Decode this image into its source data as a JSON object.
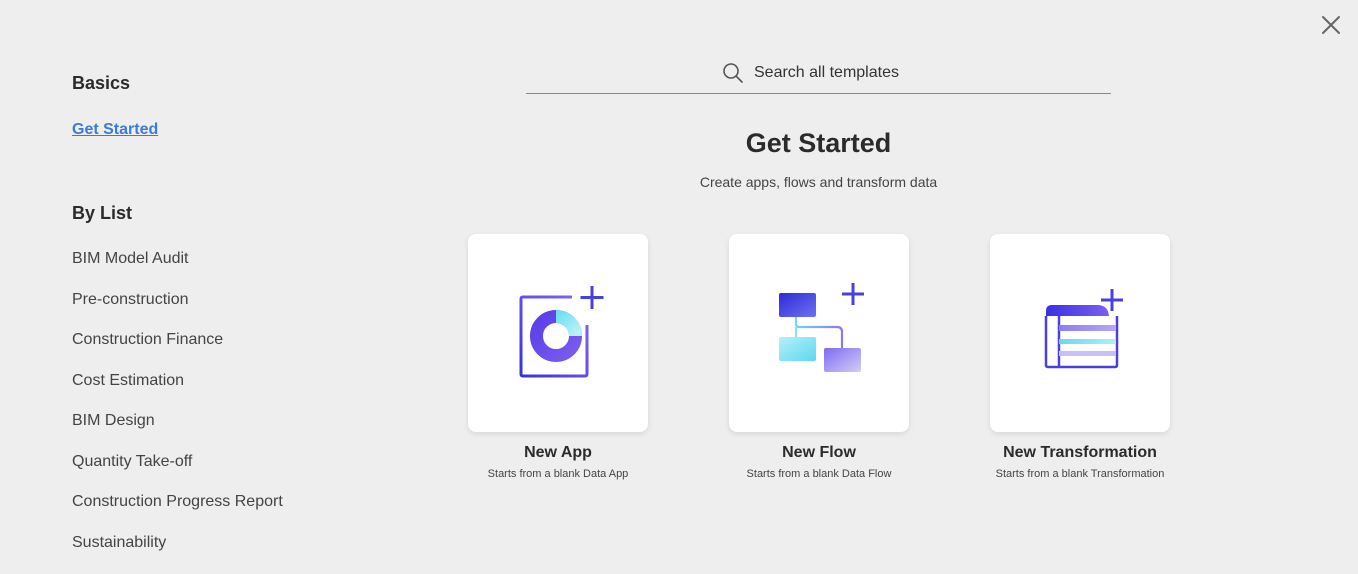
{
  "sidebar": {
    "basics_heading": "Basics",
    "get_started_link": "Get Started",
    "by_list_heading": "By List",
    "items": [
      {
        "label": "BIM Model Audit"
      },
      {
        "label": "Pre-construction"
      },
      {
        "label": "Construction Finance"
      },
      {
        "label": "Cost Estimation"
      },
      {
        "label": "BIM Design"
      },
      {
        "label": "Quantity Take-off"
      },
      {
        "label": "Construction Progress Report"
      },
      {
        "label": "Sustainability"
      }
    ]
  },
  "search": {
    "placeholder": "Search all templates",
    "icon": "search-icon"
  },
  "main": {
    "title": "Get Started",
    "subtitle": "Create apps, flows and transform data",
    "cards": [
      {
        "title": "New App",
        "description": "Starts from a blank Data App",
        "icon": "data-app-icon"
      },
      {
        "title": "New Flow",
        "description": "Starts from a blank Data Flow",
        "icon": "data-flow-icon"
      },
      {
        "title": "New Transformation",
        "description": "Starts from a blank Transformation",
        "icon": "transformation-icon"
      }
    ]
  },
  "colors": {
    "accent": "#4a3fe0",
    "link": "#3d7bd9",
    "background": "#eeeeee"
  }
}
